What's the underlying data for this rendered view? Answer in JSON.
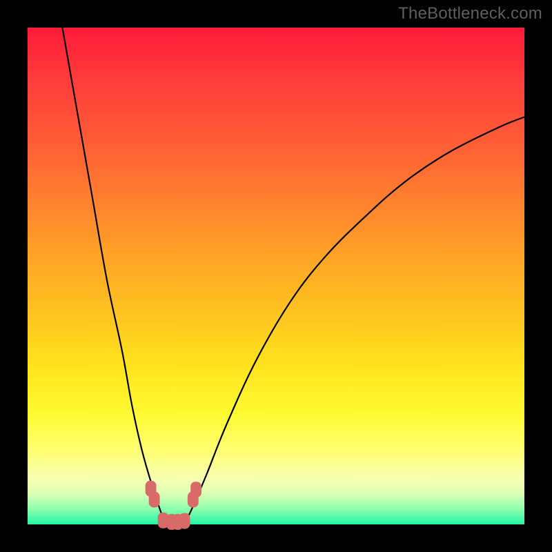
{
  "watermark": "TheBottleneck.com",
  "chart_data": {
    "type": "line",
    "title": "",
    "xlabel": "",
    "ylabel": "",
    "xlim": [
      0,
      100
    ],
    "ylim": [
      0,
      100
    ],
    "grid": false,
    "background_gradient": {
      "orientation": "vertical",
      "stops": [
        {
          "pos": 0.0,
          "color": "#ff1a39"
        },
        {
          "pos": 0.5,
          "color": "#ffb020"
        },
        {
          "pos": 0.8,
          "color": "#fff82a"
        },
        {
          "pos": 1.0,
          "color": "#22f5a5"
        }
      ]
    },
    "series": [
      {
        "name": "left-branch",
        "x": [
          7,
          10,
          13,
          16,
          19,
          21,
          23,
          25,
          27,
          27.8
        ],
        "y": [
          100,
          83,
          66,
          49,
          35,
          24,
          15,
          8,
          2,
          0
        ]
      },
      {
        "name": "right-branch",
        "x": [
          31.5,
          33,
          36,
          40,
          46,
          53,
          60,
          68,
          76,
          85,
          95,
          100
        ],
        "y": [
          0,
          3,
          10,
          20,
          33,
          45,
          54,
          62,
          69,
          75,
          80,
          82
        ]
      }
    ],
    "markers": [
      {
        "x": 24.8,
        "y": 7.2
      },
      {
        "x": 25.5,
        "y": 5.0
      },
      {
        "x": 27.3,
        "y": 0.8
      },
      {
        "x": 29.0,
        "y": 0.5
      },
      {
        "x": 30.2,
        "y": 0.5
      },
      {
        "x": 31.6,
        "y": 0.7
      },
      {
        "x": 33.3,
        "y": 5.0
      },
      {
        "x": 33.9,
        "y": 7.0
      }
    ],
    "marker_style": {
      "shape": "rounded-rect",
      "w": 2.2,
      "h": 3.2,
      "color": "#d96a6a"
    }
  }
}
